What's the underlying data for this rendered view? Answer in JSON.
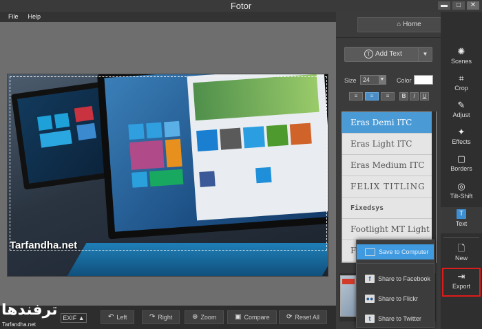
{
  "window": {
    "title": "Fotor",
    "minimize": "▬",
    "maximize": "□",
    "close": "✕"
  },
  "menu": {
    "items": [
      "File",
      "Help"
    ]
  },
  "canvas": {
    "watermark": "Tarfandha.net"
  },
  "panel": {
    "home_label": "Home",
    "add_text_label": "Add Text",
    "size_label": "Size",
    "size_value": "24",
    "color_label": "Color",
    "color_value": "#ffffff",
    "format_buttons": [
      "B",
      "I",
      "U"
    ],
    "fonts": [
      "Eras Demi ITC",
      "Eras Light ITC",
      "Eras Medium ITC",
      "FELIX TITLING",
      "Fixedsys",
      "Footlight MT Light",
      "Fo"
    ]
  },
  "export_menu": {
    "items": [
      "Save to Computer",
      "Share to Facebook",
      "Share to Flickr",
      "Share to Twitter"
    ]
  },
  "tools": {
    "items": [
      {
        "label": "Scenes",
        "icon": "✺"
      },
      {
        "label": "Crop",
        "icon": "⌗"
      },
      {
        "label": "Adjust",
        "icon": "✎"
      },
      {
        "label": "Effects",
        "icon": "✦"
      },
      {
        "label": "Borders",
        "icon": "▢"
      },
      {
        "label": "Tilt-Shift",
        "icon": "◎"
      },
      {
        "label": "Text",
        "icon": "T"
      },
      {
        "label": "New",
        "icon": "🗋"
      },
      {
        "label": "Export",
        "icon": "⇥"
      }
    ]
  },
  "bottombar": {
    "exif_label": "EXIF ▲",
    "left_label": "Left",
    "right_label": "Right",
    "zoom_label": "Zoom",
    "compare_label": "Compare",
    "reset_label": "Reset All"
  },
  "logo": {
    "arabic": "ترفندها",
    "url": "Tarfandha.net"
  },
  "colors": {
    "accent": "#4a9ad6",
    "highlight_border": "#e01b1b"
  }
}
